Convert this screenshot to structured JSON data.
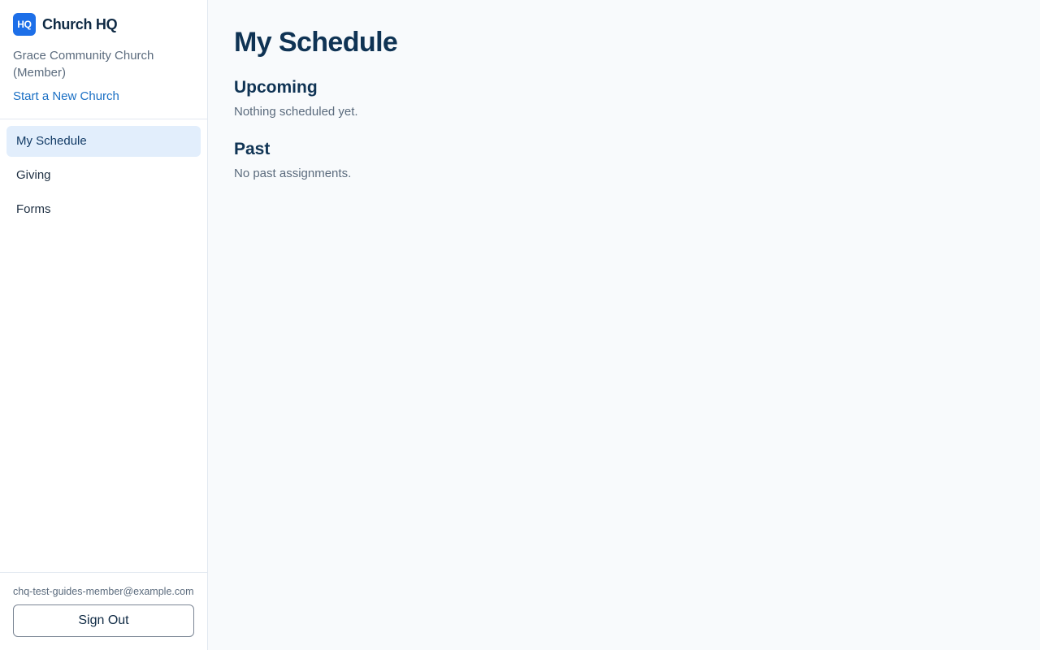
{
  "brand": {
    "logo_text": "HQ",
    "name": "Church HQ"
  },
  "church": {
    "name": "Grace Community Church (Member)",
    "new_church_link": "Start a New Church"
  },
  "nav": {
    "items": [
      {
        "label": "My Schedule",
        "active": true
      },
      {
        "label": "Giving",
        "active": false
      },
      {
        "label": "Forms",
        "active": false
      }
    ]
  },
  "user": {
    "email": "chq-test-guides-member@example.com",
    "sign_out_label": "Sign Out"
  },
  "main": {
    "title": "My Schedule",
    "sections": [
      {
        "title": "Upcoming",
        "text": "Nothing scheduled yet."
      },
      {
        "title": "Past",
        "text": "No past assignments."
      }
    ]
  },
  "colors": {
    "accent": "#1d6fe8",
    "link": "#1a6fc4",
    "active_nav_bg": "#e2eefc"
  }
}
